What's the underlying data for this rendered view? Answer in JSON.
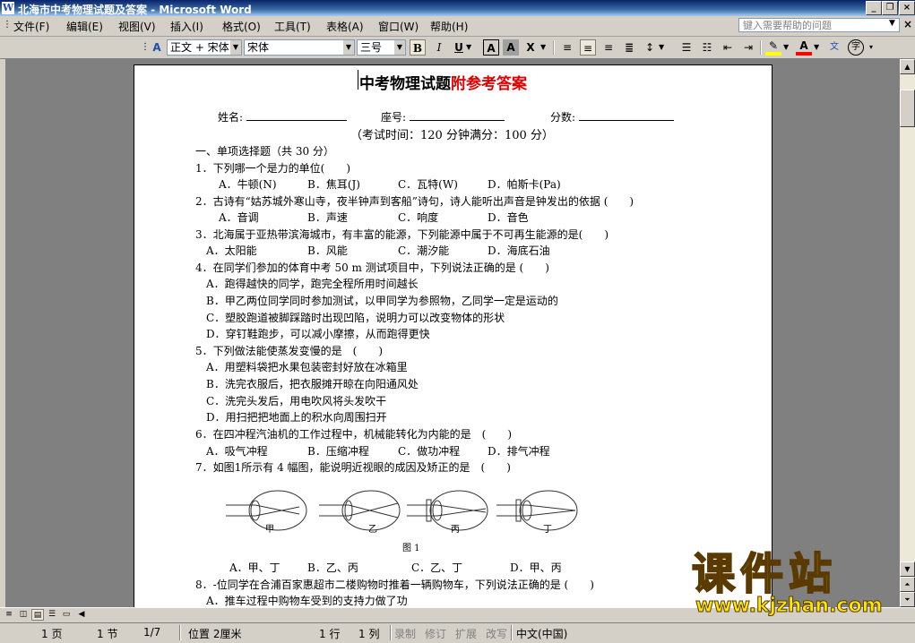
{
  "window": {
    "title": "北海市中考物理试题及答案 - Microsoft Word",
    "app_icon": "word-icon"
  },
  "menu": {
    "items": [
      "文件(F)",
      "编辑(E)",
      "视图(V)",
      "插入(I)",
      "格式(O)",
      "工具(T)",
      "表格(A)",
      "窗口(W)",
      "帮助(H)"
    ],
    "help_placeholder": "键入需要帮助的问题"
  },
  "toolbar": {
    "style": "正文 + 宋体",
    "font": "宋体",
    "size": "三号",
    "bold": "B",
    "italic": "I",
    "underline": "U",
    "char_border": "A",
    "char_shading": "A",
    "highlight_color": "#ffff00",
    "font_color": "#ff0000"
  },
  "document": {
    "title_black": "中考物理试题",
    "title_red": "附参考答案",
    "name_label": "姓名:",
    "seat_label": "座号:",
    "score_label": "分数:",
    "exam_info": "（考试时间：120 分钟满分：100 分）",
    "section1": "一、单项选择题（共 30 分）",
    "q1": "1．下列哪一个是力的单位(　　)",
    "q1_opts": [
      "A．牛顿(N)",
      "B．焦耳(J)",
      "C．瓦特(W)",
      "D．帕斯卡(Pa)"
    ],
    "q2": "2．古诗有“姑苏城外寒山寺，夜半钟声到客船”诗句，诗人能听出声音是钟发出的依据 (　　)",
    "q2_opts": [
      "A．音调",
      "B．声速",
      "C．响度",
      "D．音色"
    ],
    "q3": "3．北海属于亚热带滨海城市，有丰富的能源，下列能源中属于不可再生能源的是(　　)",
    "q3_opts": [
      "A．太阳能",
      "B．风能",
      "C．潮汐能",
      "D．海底石油"
    ],
    "q4": "4．在同学们参加的体育中考 50 m 测试项目中，下列说法正确的是 (　　)",
    "q4_opts": [
      "A．跑得越快的同学，跑完全程所用时间越长",
      "B．甲乙两位同学同时参加测试，以甲同学为参照物，乙同学一定是运动的",
      "C．塑胶跑道被脚踩踏时出现凹陷，说明力可以改变物体的形状",
      "D．穿钉鞋跑步，可以减小摩擦，从而跑得更快"
    ],
    "q5": "5．下列做法能使蒸发变慢的是　(　　)",
    "q5_opts": [
      "A．用塑料袋把水果包装密封好放在冰箱里",
      "B．洗完衣服后，把衣服摊开晾在向阳通风处",
      "C．洗完头发后，用电吹风将头发吹干",
      "D．用扫把把地面上的积水向周围扫开"
    ],
    "q6": "6．在四冲程汽油机的工作过程中，机械能转化为内能的是　(　　)",
    "q6_opts": [
      "A．吸气冲程",
      "B．压缩冲程",
      "C．做功冲程",
      "D．排气冲程"
    ],
    "q7": "7．如图1所示有 4 幅图，能说明近视眼的成因及矫正的是　(　　)",
    "fig_labels": [
      "甲",
      "乙",
      "丙",
      "丁"
    ],
    "fig_caption": "图 1",
    "q7_opts": [
      "A．甲、丁",
      "B．乙、丙",
      "C．乙、丁",
      "D．甲、丙"
    ],
    "q8": "8．-位同学在合浦百家惠超市二楼购物时推着一辆购物车，下列说法正确的是 (　　)",
    "q8_opt_a": "A．推车过程中购物车受到的支持力做了功"
  },
  "status": {
    "page": "1 页",
    "section": "1 节",
    "page_of": "1/7",
    "position": "位置 2厘米",
    "line": "1 行",
    "column": "1 列",
    "rec": "录制",
    "trk": "修订",
    "ext": "扩展",
    "ovr": "改写",
    "language": "中文(中国)"
  },
  "watermark": {
    "text": "课件站",
    "url": "www.kjzhan.com"
  }
}
